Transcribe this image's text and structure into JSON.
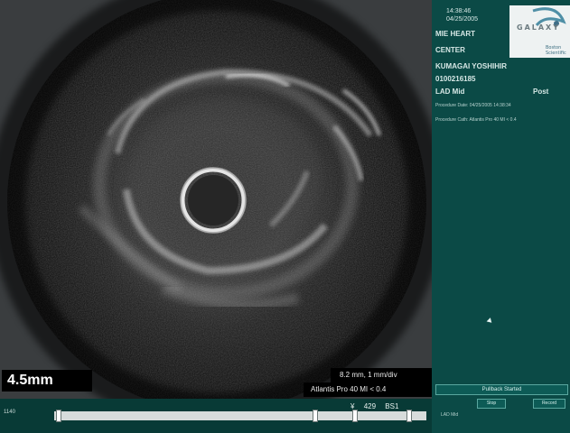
{
  "header": {
    "time": "14:38:46",
    "date": "04/25/2005",
    "institution_line1": "MIE HEART",
    "institution_line2": "CENTER",
    "patient_name": "KUMAGAI YOSHIHIR",
    "patient_id": "0100216185",
    "vessel": "LAD Mid",
    "phase": "Post",
    "procedure_date": "Procedure Date: 04/25/2005  14:38:34",
    "procedure_cath": "Procedure Cath: Atlantis Pro 40 MI < 0.4"
  },
  "logo": {
    "text": "GALAXY",
    "sub_line1": "Boston",
    "sub_line2": "Scientific"
  },
  "overlay": {
    "scale": "4.5mm",
    "measurement": "8.2 mm, 1 mm/div",
    "catheter": "Atlantis Pro 40 MI < 0.4"
  },
  "bottom": {
    "left_counter": "1140",
    "frame_symbol": "¥",
    "frame_number": "429",
    "bs": "BS1",
    "lad_mid_mini": "LAD Mid",
    "pullback_label": "Pullback Started",
    "mini_btn_1": "Stop",
    "mini_btn_2": "Record"
  },
  "colors": {
    "panel": "#0b4a46",
    "bottom": "#083a36",
    "text": "#d7e8e6"
  }
}
